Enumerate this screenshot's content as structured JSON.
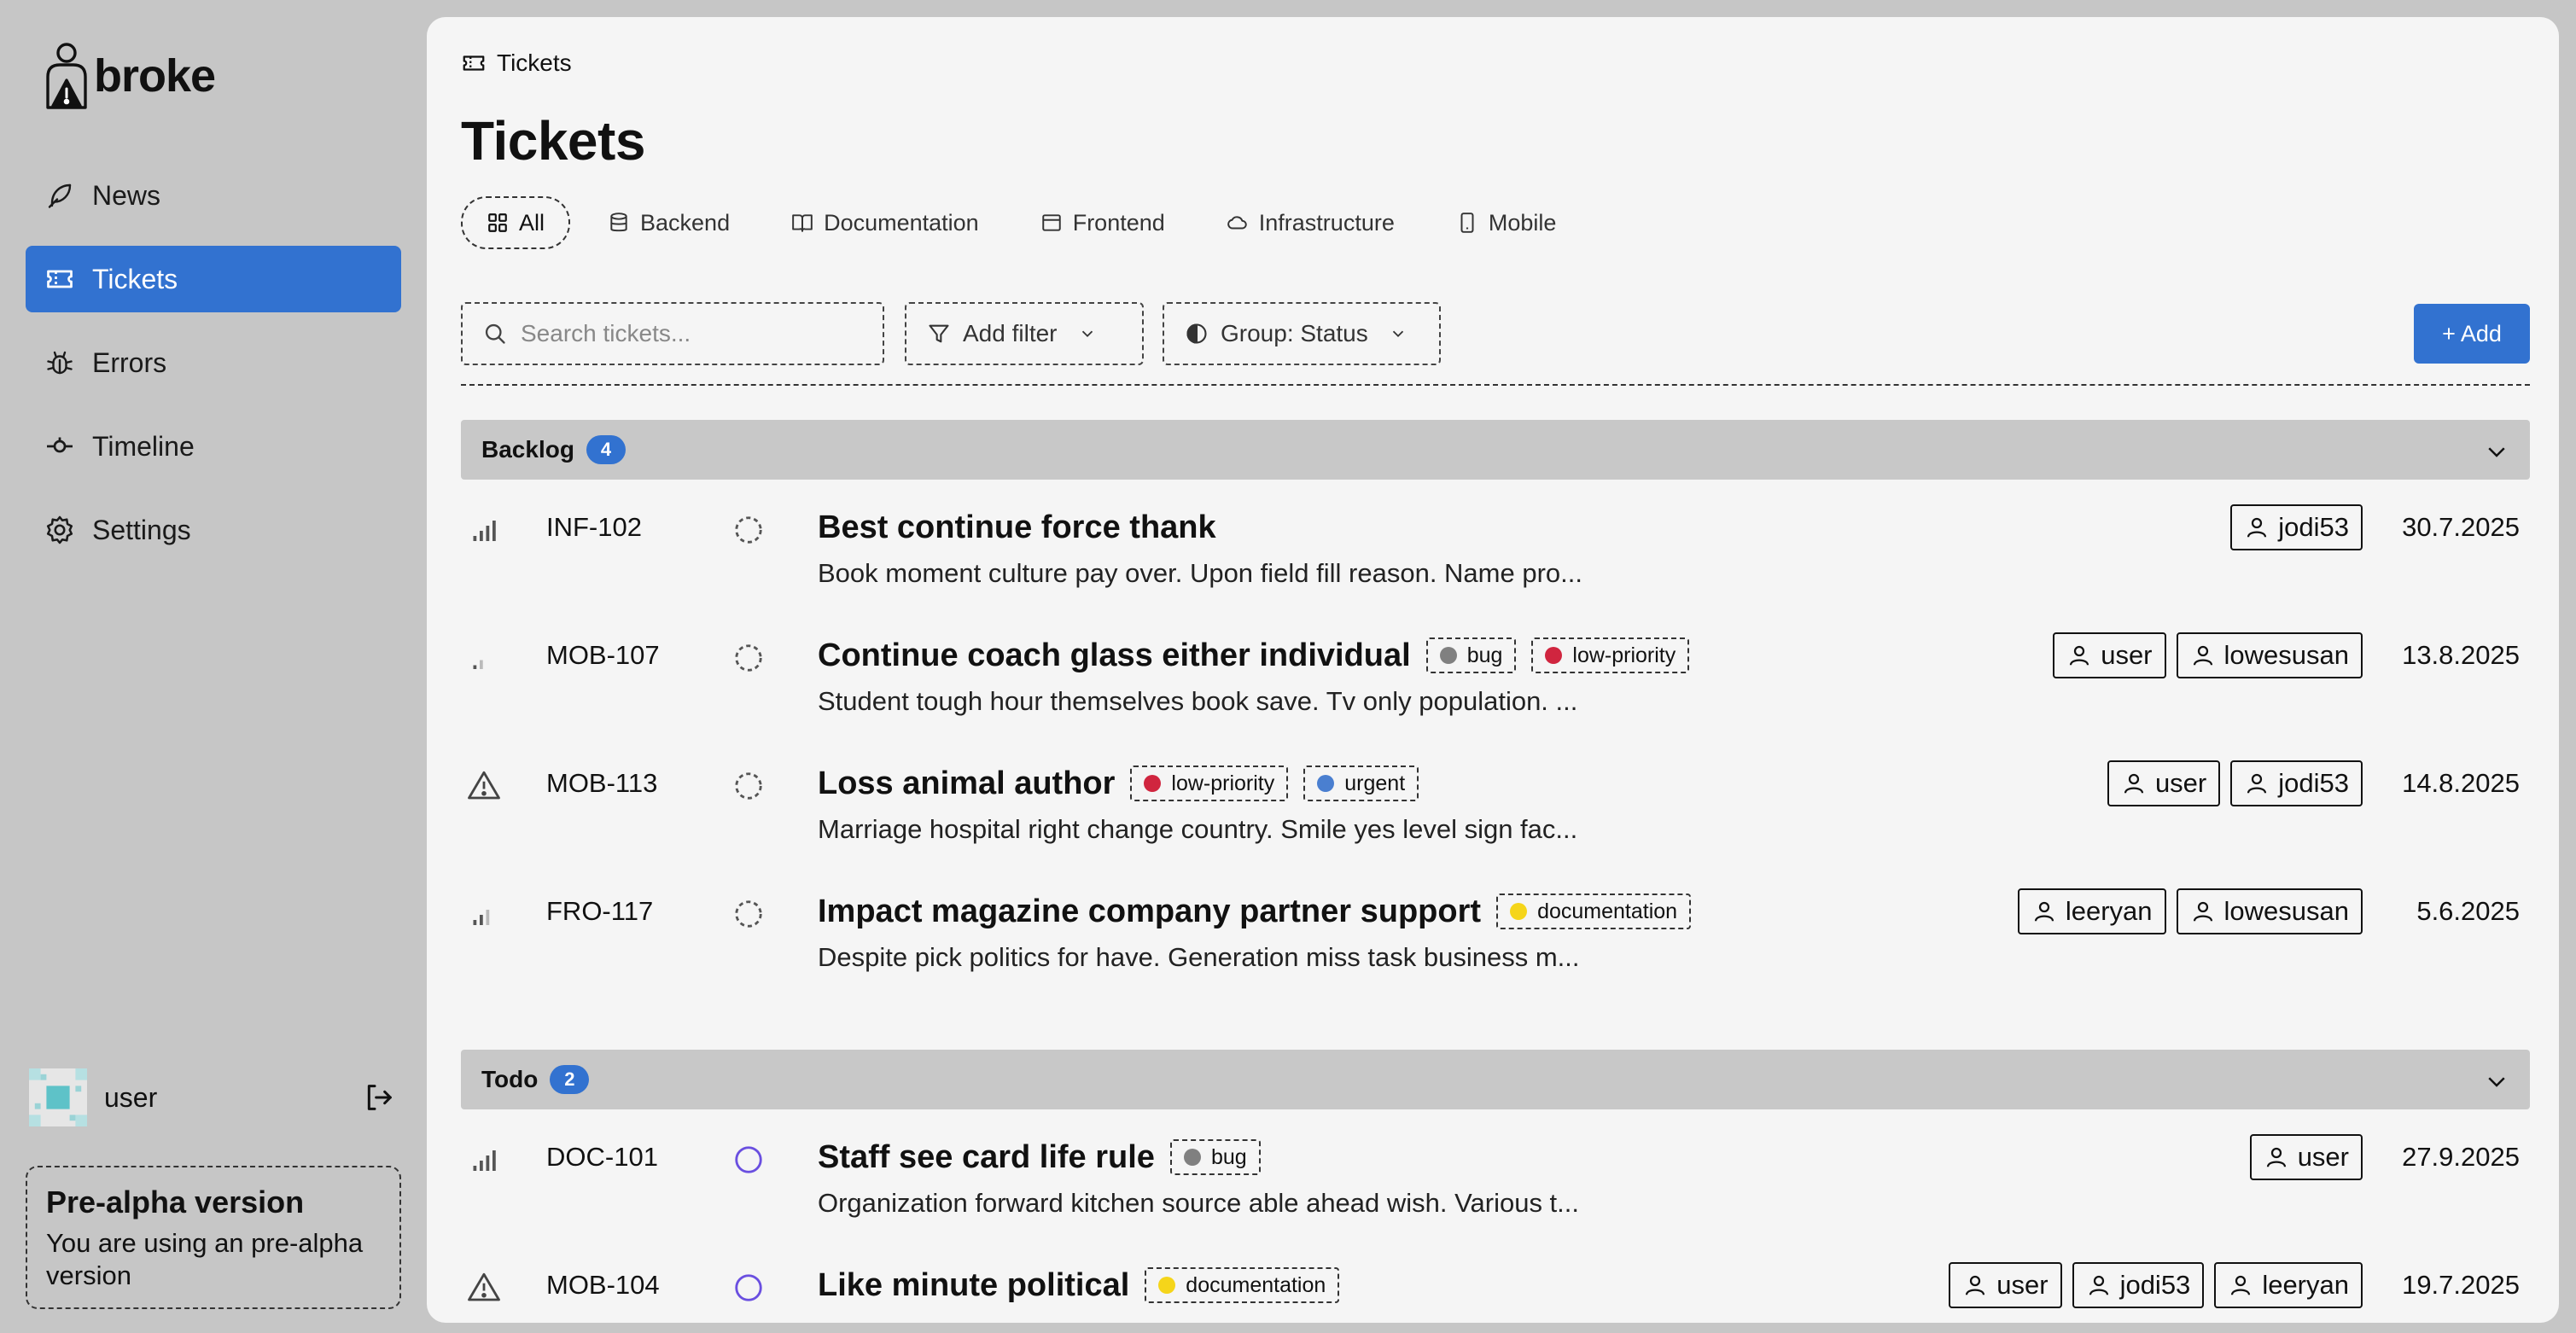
{
  "brand": {
    "name": "broke"
  },
  "nav": [
    {
      "label": "News",
      "icon": "feather-icon"
    },
    {
      "label": "Tickets",
      "icon": "ticket-icon",
      "active": true
    },
    {
      "label": "Errors",
      "icon": "bug-icon"
    },
    {
      "label": "Timeline",
      "icon": "timeline-icon"
    },
    {
      "label": "Settings",
      "icon": "gear-icon"
    }
  ],
  "user": {
    "name": "user"
  },
  "notice": {
    "title": "Pre-alpha version",
    "text": "You are using an pre-alpha version"
  },
  "breadcrumb": {
    "label": "Tickets"
  },
  "page": {
    "title": "Tickets"
  },
  "tabs": [
    {
      "label": "All",
      "active": true
    },
    {
      "label": "Backend"
    },
    {
      "label": "Documentation"
    },
    {
      "label": "Frontend"
    },
    {
      "label": "Infrastructure"
    },
    {
      "label": "Mobile"
    }
  ],
  "toolbar": {
    "search_placeholder": "Search tickets...",
    "filter_label": "Add filter",
    "group_label": "Group: Status",
    "add_label": "+ Add"
  },
  "colors": {
    "accent": "#3272d0",
    "bug": "#808080",
    "low_priority": "#d0253f",
    "urgent": "#4a7fd0",
    "documentation": "#f5d51a",
    "todo_status": "#6a4fe0"
  },
  "groups": [
    {
      "name": "Backlog",
      "count": "4",
      "tickets": [
        {
          "id": "INF-102",
          "priority": "high",
          "status": "backlog",
          "title": "Best continue force thank",
          "labels": [],
          "description": "Book moment culture pay over. Upon field fill reason. Name pro...",
          "assignees": [
            "jodi53"
          ],
          "date": "30.7.2025"
        },
        {
          "id": "MOB-107",
          "priority": "low",
          "status": "backlog",
          "title": "Continue coach glass either individual",
          "labels": [
            {
              "name": "bug",
              "color": "#808080"
            },
            {
              "name": "low-priority",
              "color": "#d0253f"
            }
          ],
          "description": "Student tough hour themselves book save. Tv only population. ...",
          "assignees": [
            "user",
            "lowesusan"
          ],
          "date": "13.8.2025"
        },
        {
          "id": "MOB-113",
          "priority": "urgent",
          "status": "backlog",
          "title": "Loss animal author",
          "labels": [
            {
              "name": "low-priority",
              "color": "#d0253f"
            },
            {
              "name": "urgent",
              "color": "#4a7fd0"
            }
          ],
          "description": "Marriage hospital right change country. Smile yes level sign fac...",
          "assignees": [
            "user",
            "jodi53"
          ],
          "date": "14.8.2025"
        },
        {
          "id": "FRO-117",
          "priority": "medium",
          "status": "backlog",
          "title": "Impact magazine company partner support",
          "labels": [
            {
              "name": "documentation",
              "color": "#f5d51a"
            }
          ],
          "description": "Despite pick politics for have. Generation miss task business m...",
          "assignees": [
            "leeryan",
            "lowesusan"
          ],
          "date": "5.6.2025"
        }
      ]
    },
    {
      "name": "Todo",
      "count": "2",
      "tickets": [
        {
          "id": "DOC-101",
          "priority": "high",
          "status": "todo",
          "title": "Staff see card life rule",
          "labels": [
            {
              "name": "bug",
              "color": "#808080"
            }
          ],
          "description": "Organization forward kitchen source able ahead wish. Various t...",
          "assignees": [
            "user"
          ],
          "date": "27.9.2025"
        },
        {
          "id": "MOB-104",
          "priority": "urgent",
          "status": "todo",
          "title": "Like minute political",
          "labels": [
            {
              "name": "documentation",
              "color": "#f5d51a"
            }
          ],
          "description": "",
          "assignees": [
            "user",
            "jodi53",
            "leeryan"
          ],
          "date": "19.7.2025"
        }
      ]
    }
  ]
}
